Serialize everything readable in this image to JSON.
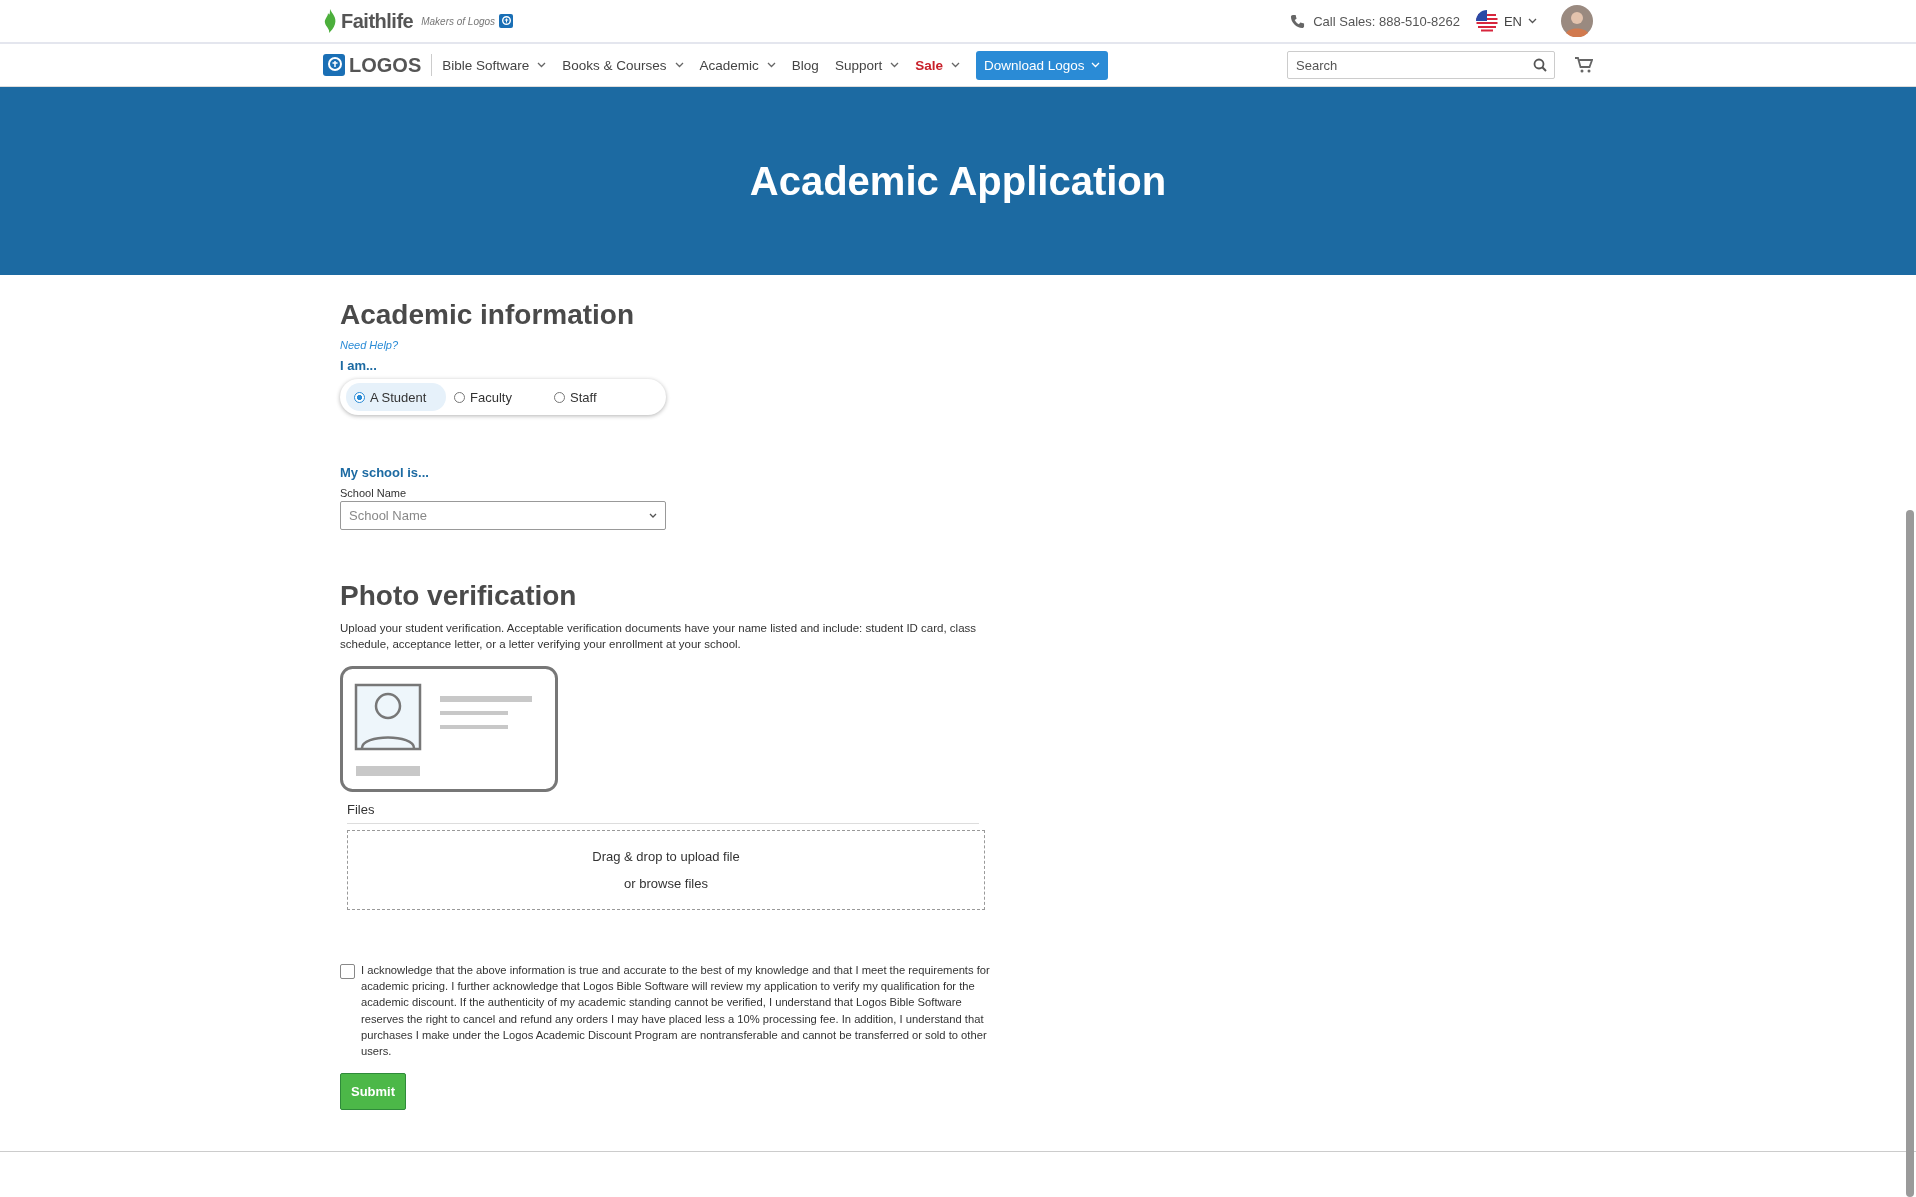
{
  "top_bar": {
    "brand": "Faithlife",
    "tagline": "Makers of Logos",
    "phone": "Call Sales: 888-510-8262",
    "language": "EN"
  },
  "nav": {
    "logo": "LOGOS",
    "items": [
      {
        "label": "Bible Software",
        "dropdown": true,
        "kind": "link"
      },
      {
        "label": "Books & Courses",
        "dropdown": true,
        "kind": "link"
      },
      {
        "label": "Academic",
        "dropdown": true,
        "kind": "link"
      },
      {
        "label": "Blog",
        "dropdown": false,
        "kind": "link"
      },
      {
        "label": "Support",
        "dropdown": true,
        "kind": "link"
      },
      {
        "label": "Sale",
        "dropdown": true,
        "kind": "sale"
      },
      {
        "label": "Download Logos",
        "dropdown": true,
        "kind": "button"
      }
    ],
    "search": {
      "placeholder": "Search"
    }
  },
  "banner": {
    "title": "Academic Application"
  },
  "academic": {
    "heading": "Academic information",
    "help": "Need Help?",
    "role_label": "I am...",
    "roles": [
      {
        "label": "A Student",
        "selected": true
      },
      {
        "label": "Faculty",
        "selected": false
      },
      {
        "label": "Staff",
        "selected": false
      }
    ],
    "school_label": "My school is...",
    "school_field_label": "School Name",
    "school_placeholder": "School Name"
  },
  "photo": {
    "heading": "Photo verification",
    "description": "Upload your student verification. Acceptable verification documents have your name listed and include: student ID card, class schedule, acceptance letter, or a letter verifying your enrollment at your school.",
    "files_label": "Files",
    "drop_text": "Drag & drop to upload file",
    "browse_text": "or browse files"
  },
  "acknowledgement": {
    "checked": false,
    "text": "I acknowledge that the above information is true and accurate to the best of my knowledge and that I meet the requirements for academic pricing. I further acknowledge that Logos Bible Software will review my application to verify my qualification for the academic discount. If the authenticity of my academic standing cannot be verified, I understand that Logos Bible Software reserves the right to cancel and refund any orders I may have placed less a 10% processing fee. In addition, I understand that purchases I make under the Logos Academic Discount Program are nontransferable and cannot be transferred or sold to other users."
  },
  "submit": "Submit"
}
